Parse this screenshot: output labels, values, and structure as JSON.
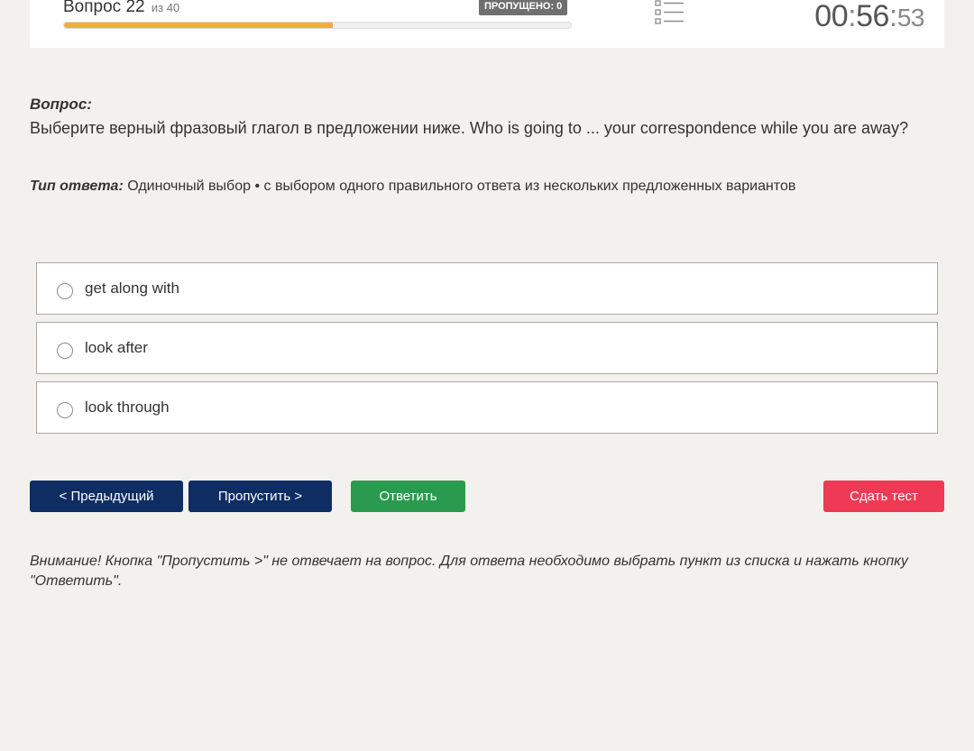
{
  "header": {
    "question_label": "Вопрос 22",
    "question_of": "из 40",
    "skipped_badge": "ПРОПУЩЕНО: 0",
    "progress_fraction": 0.53,
    "progress_color": "#f2ad3a",
    "list_icon": "list-icon",
    "timer": {
      "hh": "00",
      "mm": "56",
      "ss": "53"
    }
  },
  "question": {
    "label": "Вопрос:",
    "text": "Выберите верный фразовый глагол в предложении ниже. Who is going to ... your correspondence while you are away?",
    "answer_type_label": "Тип ответа:",
    "answer_type_value": "Одиночный выбор • с выбором одного правильного ответа из нескольких предложенных вариантов"
  },
  "options": [
    {
      "text": "get along with"
    },
    {
      "text": "look after"
    },
    {
      "text": "look through"
    }
  ],
  "buttons": {
    "prev": "< Предыдущий",
    "skip": "Пропустить >",
    "answer": "Ответить",
    "submit": "Сдать тест"
  },
  "warning": "Внимание! Кнопка \"Пропустить >\" не отвечает на вопрос. Для ответа необходимо выбрать пункт из списка и нажать кнопку \"Ответить\".",
  "colors": {
    "primary": "#0d2d63",
    "answer": "#2a9b4e",
    "submit": "#ee3a55"
  }
}
